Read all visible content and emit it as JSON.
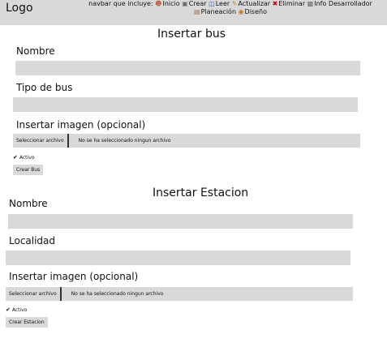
{
  "navbar": {
    "logo": "Logo",
    "intro": "navbar que incluye:",
    "links": [
      {
        "label": "Inicio",
        "icon": "person-icon"
      },
      {
        "label": "Crear",
        "icon": "monitor-icon"
      },
      {
        "label": "Leer",
        "icon": "book-icon"
      },
      {
        "label": "Actualizar",
        "icon": "pencil-icon"
      },
      {
        "label": "Eliminar",
        "icon": "cross-icon"
      },
      {
        "label": "Info Desarrollador",
        "icon": "developer-icon"
      },
      {
        "label": "Planeación",
        "icon": "chart-icon"
      },
      {
        "label": "Diseño",
        "icon": "palette-icon"
      }
    ]
  },
  "bus_form": {
    "title": "Insertar bus",
    "nombre_label": "Nombre",
    "tipo_label": "Tipo de bus",
    "imagen_label": "Insertar imagen (opcional)",
    "file_button": "Seleccionar archivo",
    "file_status": "No se ha seleccionado ningun archivo",
    "activo_label": "Activo",
    "submit": "Crear Bus"
  },
  "estacion_form": {
    "title": "Insertar Estacion",
    "nombre_label": "Nombre",
    "localidad_label": "Localidad",
    "imagen_label": "Insertar imagen (opcional)",
    "file_button": "Seleccionar archivo",
    "file_status": "No se ha seleccionado ningun archivo",
    "activo_label": "Activo",
    "submit": "Crear Estacion"
  }
}
